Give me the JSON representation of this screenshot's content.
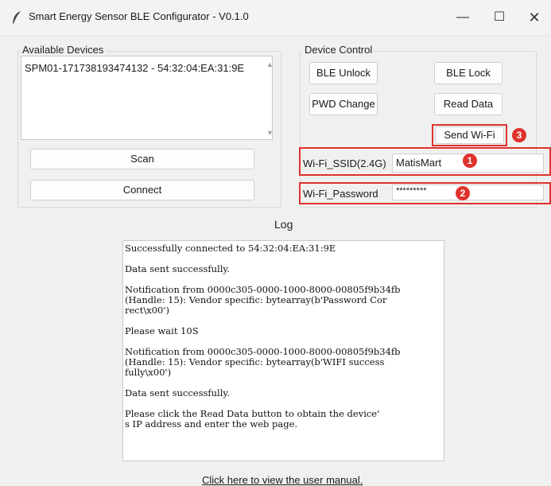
{
  "window": {
    "title": "Smart Energy Sensor BLE Configurator - V0.1.0",
    "minimize": "—",
    "maximize": "☐",
    "close": "✕"
  },
  "devices": {
    "group_label": "Available Devices",
    "items": [
      "SPM01-171738193474132 - 54:32:04:EA:31:9E"
    ],
    "scan_label": "Scan",
    "connect_label": "Connect"
  },
  "control": {
    "group_label": "Device Control",
    "ble_unlock": "BLE Unlock",
    "ble_lock": "BLE Lock",
    "pwd_change": "PWD Change",
    "read_data": "Read Data",
    "send_wifi": "Send Wi-Fi",
    "ssid_label": "Wi-Fi_SSID(2.4G)",
    "ssid_value": "MatisMart",
    "password_label": "Wi-Fi_Password",
    "password_value": "*********"
  },
  "badges": [
    "1",
    "2",
    "3"
  ],
  "log": {
    "title": "Log",
    "lines": [
      "Successfully connected to 54:32:04:EA:31:9E",
      "Data sent successfully.",
      "Notification from 0000c305-0000-1000-8000-00805f9b34fb\n(Handle: 15): Vendor specific: bytearray(b'Password Cor\nrect\\x00')",
      "Please wait 10S",
      "Notification from 0000c305-0000-1000-8000-00805f9b34fb\n(Handle: 15): Vendor specific: bytearray(b'WIFI success\nfully\\x00')",
      "Data sent successfully.",
      "Please click the Read Data button to obtain the device'\ns IP address and enter the web page."
    ]
  },
  "footer": {
    "manual_link": "Click here to view the user manual."
  },
  "colors": {
    "annotation_red": "#e0322d",
    "window_bg": "#f0f0f0"
  }
}
